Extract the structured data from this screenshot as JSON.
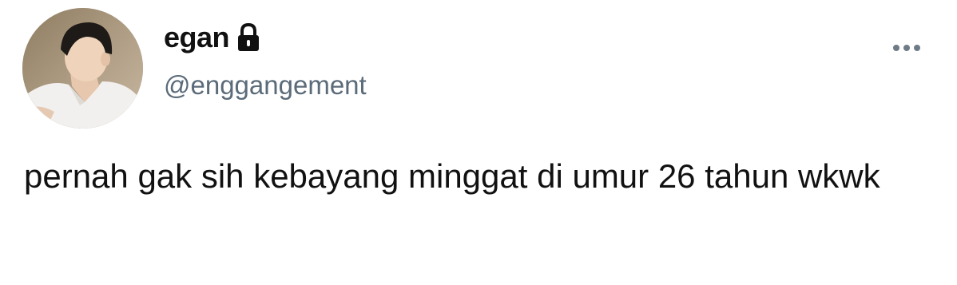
{
  "tweet": {
    "author": {
      "display_name": "egan",
      "handle": "@enggangement",
      "protected_icon": "lock-icon",
      "avatar": "profile-photo"
    },
    "more_icon": "more-horizontal-icon",
    "text": "pernah gak sih kebayang minggat di umur 26 tahun wkwk"
  },
  "colors": {
    "text_primary": "#111111",
    "text_secondary": "#5b6b79",
    "icon_muted": "#6e7b87",
    "background": "#ffffff"
  }
}
